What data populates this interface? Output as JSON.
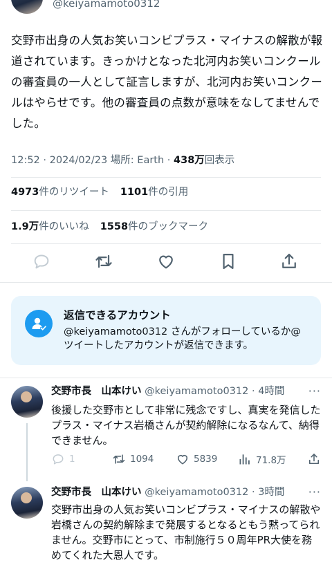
{
  "tweet": {
    "handle": "@keiyamamoto0312",
    "text": "交野市出身の人気お笑いコンビプラス・マイナスの解散が報道されています。きっかけとなった北河内お笑いコンクールの審査員の一人として証言しますが、北河内お笑いコンクールはやらせです。他の審査員の点数が意味をなしてませんでした。",
    "meta_prefix": "12:52 · 2024/02/23 場所: Earth · ",
    "views_count": "438万",
    "views_label": "回表示"
  },
  "stats": {
    "retweets_count": "4973",
    "retweets_label": "件のリツイート",
    "quotes_count": "1101",
    "quotes_label": "件の引用",
    "likes_count": "1.9万",
    "likes_label": "件のいいね",
    "bookmarks_count": "1558",
    "bookmarks_label": "件のブックマーク"
  },
  "actions": [
    "reply-icon",
    "retweet-icon",
    "like-icon",
    "bookmark-icon",
    "share-icon"
  ],
  "reply_restriction": {
    "title": "返信できるアカウント",
    "description": "@keiyamamoto0312 さんがフォローしているか@ツイートしたアカウントが返信できます。"
  },
  "replies": [
    {
      "name": "交野市長　山本けい",
      "handle": "@keiyamamoto0312",
      "time": "· 4時間",
      "more": "···",
      "text": "後援した交野市として非常に残念ですし、真実を発信したプラス・マイナス岩橋さんが契約解除になるなんて、納得できません。",
      "replies": "1",
      "retweets": "1094",
      "likes": "5839",
      "views": "71.8万"
    },
    {
      "name": "交野市長　山本けい",
      "handle": "@keiyamamoto0312",
      "time": "· 3時間",
      "more": "···",
      "text": "交野市出身の人気お笑いコンビプラス・マイナスの解散や岩橋さんの契約解除まで発展するとなるともう黙ってられません。交野市にとって、市制施行５０周年PR大使を務めてくれた大恩人です。"
    }
  ],
  "colors": {
    "text": "#0f1419",
    "muted": "#536471",
    "accent": "#1d9bf0",
    "reply_box_bg": "#e8f5fd",
    "divider": "#e6e9eb"
  }
}
